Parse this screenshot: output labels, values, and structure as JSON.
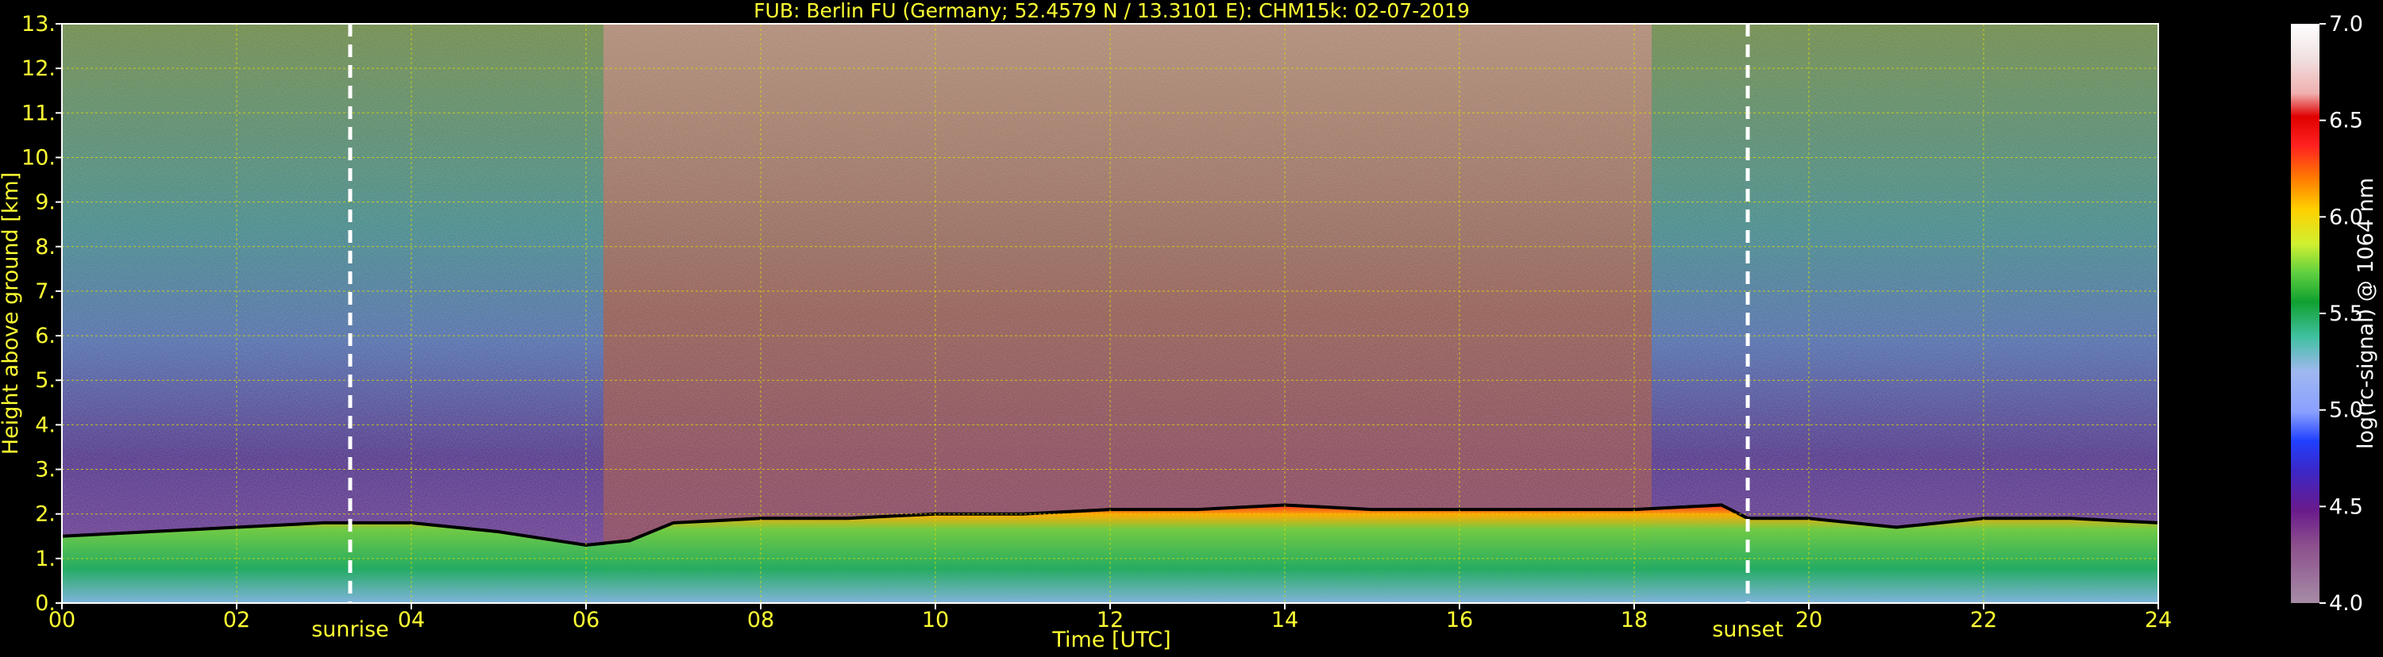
{
  "chart_data": {
    "type": "heatmap",
    "title": "FUB: Berlin FU (Germany; 52.4579 N / 13.3101 E):    CHM15k: 02-07-2019",
    "xlabel": "Time [UTC]",
    "ylabel": "Height above ground [km]",
    "xlim": [
      0,
      24
    ],
    "ylim": [
      0,
      13
    ],
    "x_ticks": [
      "00",
      "02",
      "04",
      "06",
      "08",
      "10",
      "12",
      "14",
      "16",
      "18",
      "20",
      "22",
      "24"
    ],
    "y_ticks": [
      "0.",
      "1.",
      "2.",
      "3.",
      "4.",
      "5.",
      "6.",
      "7.",
      "8.",
      "9.",
      "10.",
      "11.",
      "12.",
      "13."
    ],
    "grid": true,
    "colorbar": {
      "label": "log(rc-signal) @ 1064 nm",
      "range": [
        4.0,
        7.0
      ],
      "ticks": [
        "4.0",
        "4.5",
        "5.0",
        "5.5",
        "6.0",
        "6.5",
        "7.0"
      ]
    },
    "events": [
      {
        "name": "sunrise",
        "time": 3.3
      },
      {
        "name": "sunset",
        "time": 19.3
      }
    ],
    "boundary_layer_top_km": [
      [
        0,
        1.5
      ],
      [
        1,
        1.6
      ],
      [
        2,
        1.7
      ],
      [
        3,
        1.8
      ],
      [
        4,
        1.8
      ],
      [
        5,
        1.6
      ],
      [
        6,
        1.3
      ],
      [
        6.5,
        1.4
      ],
      [
        7,
        1.8
      ],
      [
        8,
        1.9
      ],
      [
        9,
        1.9
      ],
      [
        10,
        2.0
      ],
      [
        11,
        2.0
      ],
      [
        12,
        2.1
      ],
      [
        13,
        2.1
      ],
      [
        14,
        2.2
      ],
      [
        15,
        2.1
      ],
      [
        16,
        2.1
      ],
      [
        17,
        2.1
      ],
      [
        18,
        2.1
      ],
      [
        19,
        2.2
      ],
      [
        19.3,
        1.9
      ],
      [
        20,
        1.9
      ],
      [
        21,
        1.7
      ],
      [
        22,
        1.9
      ],
      [
        23,
        1.9
      ],
      [
        24,
        1.8
      ]
    ]
  }
}
